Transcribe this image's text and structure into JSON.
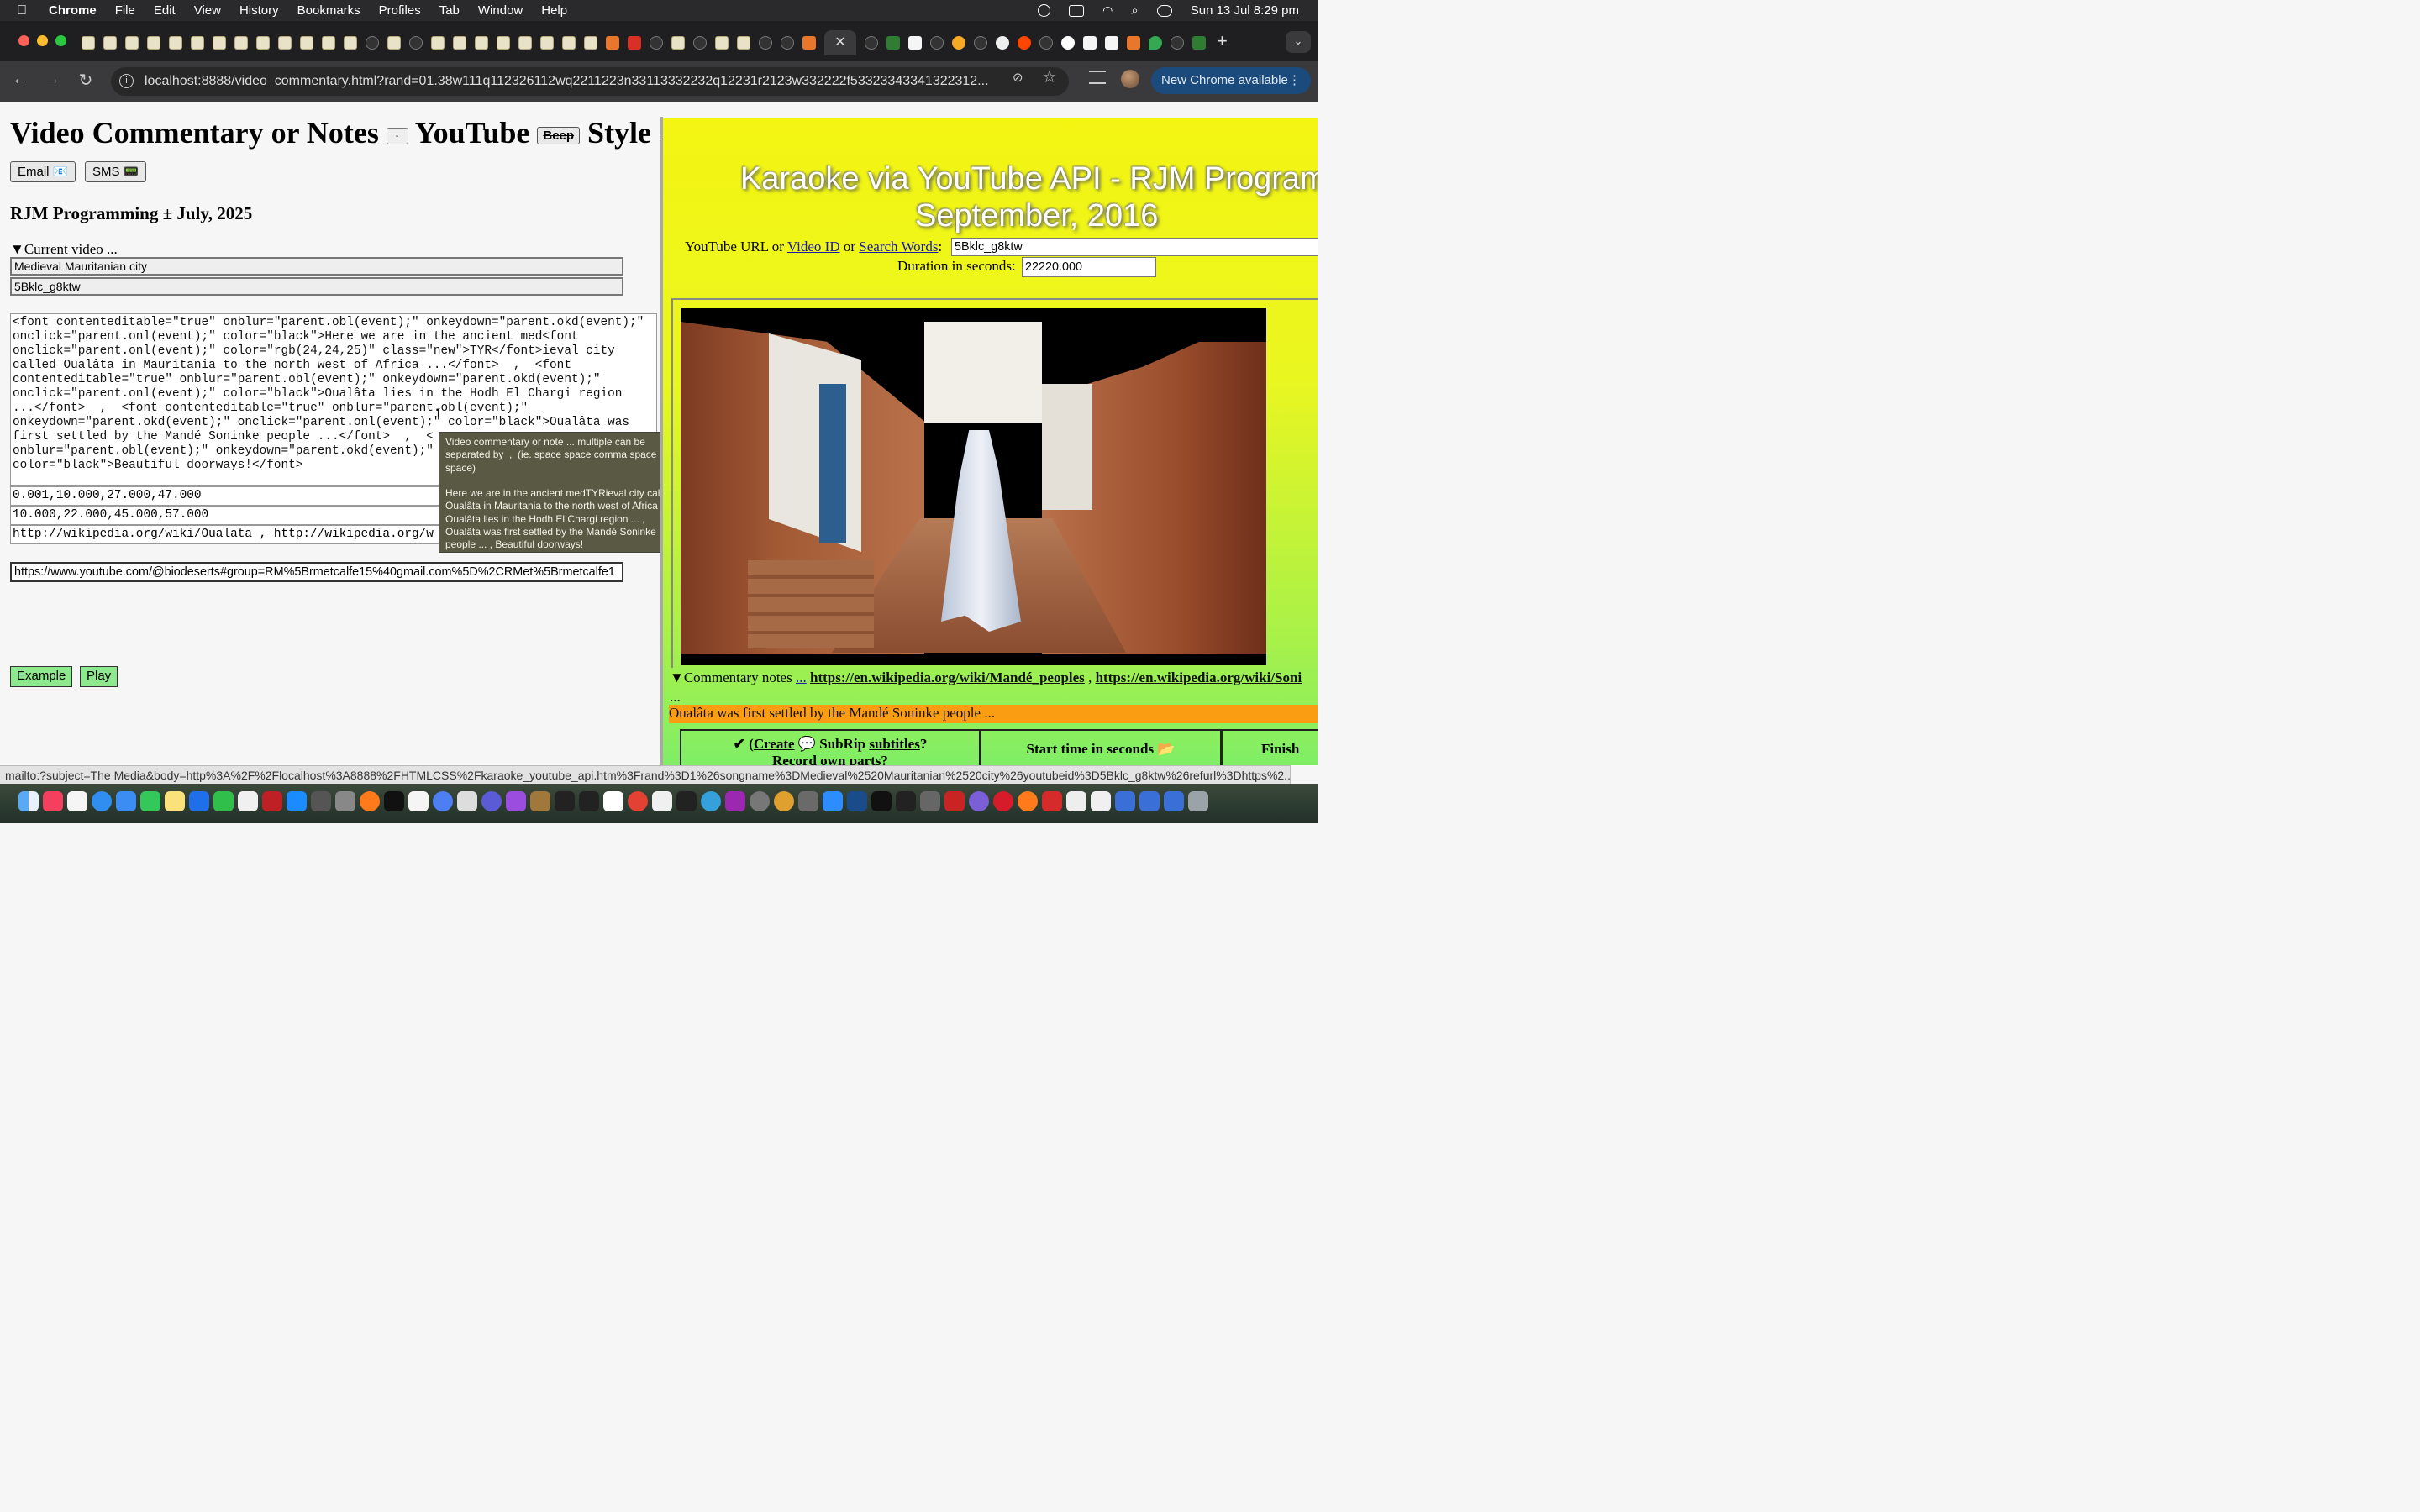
{
  "menubar": {
    "app_name": "Chrome",
    "items": [
      "File",
      "Edit",
      "View",
      "History",
      "Bookmarks",
      "Profiles",
      "Tab",
      "Window",
      "Help"
    ],
    "datetime": "Sun 13 Jul  8:29 pm"
  },
  "browser": {
    "active_tab_close": "✕",
    "new_tab": "+",
    "address": "localhost:8888/video_commentary.html?rand=01.38w111q112326112wq2211223n33113332232q12231r2123w332222f53323343341322312...",
    "update_button": "New Chrome available",
    "update_menu": "⋮"
  },
  "left": {
    "title_part1": "Video Commentary or Notes",
    "select_small": "·",
    "title_part2": "YouTube",
    "beep_button": "Beep",
    "title_part3": "Style -",
    "email_button": "Email 📧",
    "sms_button": "SMS 📟",
    "byline": "RJM Programming ± July, 2025",
    "summary": "▼Current video ...",
    "video_title": "Medieval Mauritanian city",
    "video_id": "5Bklc_g8ktw",
    "code_text": "<font contenteditable=\"true\" onblur=\"parent.obl(event);\" onkeydown=\"parent.okd(event);\"\nonclick=\"parent.onl(event);\" color=\"black\">Here we are in the ancient med<font\nonclick=\"parent.onl(event);\" color=\"rgb(24,24,25)\" class=\"new\">TYR</font>ieval city\ncalled Oualâta in Mauritania to the north west of Africa ...</font>  ,  <font\ncontenteditable=\"true\" onblur=\"parent.obl(event);\" onkeydown=\"parent.okd(event);\"\nonclick=\"parent.onl(event);\" color=\"black\">Oualâta lies in the Hodh El Chargi region\n...</font>  ,  <font contenteditable=\"true\" onblur=\"parent.obl(event);\"\nonkeydown=\"parent.okd(event);\" onclick=\"parent.onl(event);\" color=\"black\">Oualâta was\nfirst settled by the Mandé Soninke people ...</font>  ,  <\nonblur=\"parent.obl(event);\" onkeydown=\"parent.okd(event);\"\ncolor=\"black\">Beautiful doorways!</font>",
    "start_times": "0.001,10.000,27.000,47.000",
    "end_times": "10.000,22.000,45.000,57.000",
    "links": "http://wikipedia.org/wiki/Oualata , http://wikipedia.org/w",
    "url_field": "https://www.youtube.com/@biodeserts#group=RM%5Brmetcalfe15%40gmail.com%5D%2CRMet%5Brmetcalfe1",
    "example_button": "Example",
    "play_button": "Play",
    "tooltip": "Video commentary or note ... multiple can be separated by  ,  (ie. space space comma space space)\n\nHere we are in the ancient medTYRieval city called Oualâta in Mauritania to the north west of Africa ... , Oualâta lies in the Hodh El Chargi region ... , Oualâta was first settled by the Mandé Soninke people ... , Beautiful doorways!"
  },
  "right": {
    "title_line1": "Karaoke via YouTube API - RJM Programming",
    "title_line2": "September, 2016",
    "yt_label_1": "YouTube URL or ",
    "yt_link_video_id": "Video ID",
    "yt_label_or": " or ",
    "yt_link_search": "Search Words",
    "yt_label_colon": ":",
    "yt_input": "5Bklc_g8ktw",
    "duration_label": "Duration in seconds:",
    "duration_input": "22220.000",
    "notes_summary": "▼Commentary notes ",
    "notes_ellipsis_link": "...",
    "notes_link1": "https://en.wikipedia.org/wiki/Mandé_peoples",
    "notes_sep": " , ",
    "notes_link2": "https://en.wikipedia.org/wiki/Soni",
    "notes_more": "...",
    "current_note": "Oualâta was first settled by the Mandé Soninke people ...",
    "table": {
      "cell1_prefix": "✔ (",
      "cell1_create": "Create",
      "cell1_mid": " 💬 SubRip ",
      "cell1_subtitles": "subtitles",
      "cell1_suffix": "?",
      "cell1_line2": "Record own parts?",
      "cell2": "Start time in seconds 📂",
      "cell3": "Finish"
    }
  },
  "statusbar": "mailto:?subject=The Media&body=http%3A%2F%2Flocalhost%3A8888%2FHTMLCSS%2Fkaraoke_youtube_api.htm%3Frand%3D1%26songname%3DMedieval%2520Mauritanian%2520city%26youtubeid%3D5Bklc_g8ktw%26refurl%3Dhttps%2..."
}
